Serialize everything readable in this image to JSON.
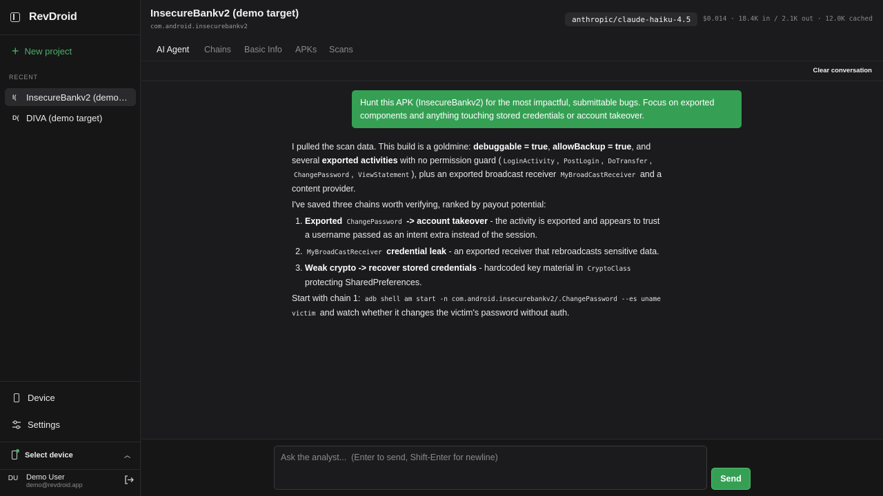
{
  "app": {
    "name": "RevDroid"
  },
  "sidebar": {
    "new_project": "New project",
    "recent_label": "RECENT",
    "projects": [
      {
        "abbr": "I(",
        "name": "InsecureBankv2 (demo target)",
        "active": true
      },
      {
        "abbr": "D(",
        "name": "DIVA (demo target)",
        "active": false
      }
    ],
    "nav": {
      "device": "Device",
      "settings": "Settings"
    },
    "select_device": "Select device",
    "user": {
      "initials": "DU",
      "name": "Demo User",
      "email": "demo@revdroid.app"
    }
  },
  "header": {
    "title": "InsecureBankv2 (demo target)",
    "package": "com.android.insecurebankv2",
    "model": "anthropic/claude-haiku-4.5",
    "usage": "$0.014 · 18.4K in / 2.1K out · 12.0K cached"
  },
  "tabs": [
    "AI Agent",
    "Chains",
    "Basic Info",
    "APKs",
    "Scans"
  ],
  "active_tab": "AI Agent",
  "toolbar": {
    "clear_label": "Clear conversation"
  },
  "chat": {
    "user_message": "Hunt this APK (InsecureBankv2) for the most impactful, submittable bugs. Focus on exported components and anything touching stored credentials or account takeover.",
    "assistant": {
      "p1": {
        "t1": "I pulled the scan data. This build is a goldmine: ",
        "b1": "debuggable = true",
        "t2": ", ",
        "b2": "allowBackup = true",
        "t3": ", and several ",
        "b3": "exported activities",
        "t4": " with no permission guard (",
        "c1": "LoginActivity",
        "t5": ", ",
        "c2": "PostLogin",
        "t6": ", ",
        "c3": "DoTransfer",
        "t7": ", ",
        "c4": "ChangePassword",
        "t8": ", ",
        "c5": "ViewStatement",
        "t9": "), plus an exported broadcast receiver ",
        "c6": "MyBroadCastReceiver",
        "t10": " and a content provider."
      },
      "p2": "I've saved three chains worth verifying, ranked by payout potential:",
      "items": [
        {
          "b1": "Exported ",
          "c": "ChangePassword",
          "b2": " -> account takeover",
          "t": " - the activity is exported and appears to trust a username passed as an intent extra instead of the session."
        },
        {
          "c": "MyBroadCastReceiver",
          "b2": " credential leak",
          "t": " - an exported receiver that rebroadcasts sensitive data."
        },
        {
          "b1": "Weak crypto -> recover stored credentials",
          "t": " - hardcoded key material in ",
          "c": "CryptoClass",
          "t2": " protecting SharedPreferences."
        }
      ],
      "p3": {
        "t1": "Start with chain 1: ",
        "c": "adb shell am start -n com.android.insecurebankv2/.ChangePassword --es uname victim",
        "t2": " and watch whether it changes the victim's password without auth."
      }
    }
  },
  "composer": {
    "placeholder": "Ask the analyst...  (Enter to send, Shift-Enter for newline)",
    "send_label": "Send"
  },
  "colors": {
    "accent": "#35a054",
    "background": "#1b1b1d",
    "sidebar": "#161617"
  }
}
